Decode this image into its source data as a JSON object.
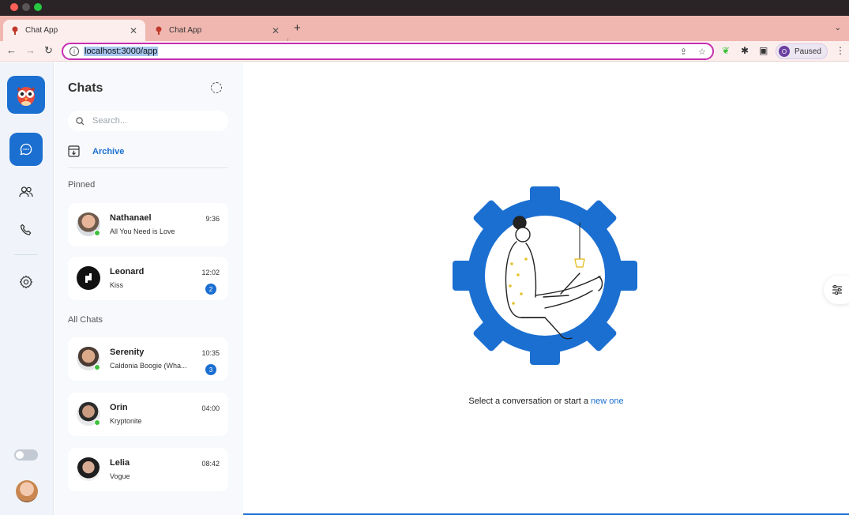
{
  "browser": {
    "tabs": [
      {
        "title": "Chat App",
        "active": true
      },
      {
        "title": "Chat App",
        "active": false
      }
    ],
    "url": "localhost:3000/app",
    "profile_status": "Paused",
    "profile_initial": "O"
  },
  "sidebar": {
    "title": "Chats",
    "search_placeholder": "Search...",
    "archive_label": "Archive",
    "pinned_label": "Pinned",
    "all_chats_label": "All Chats",
    "pinned": [
      {
        "name": "Nathanael",
        "message": "All You Need is Love",
        "time": "9:36",
        "unread": null,
        "online": true
      },
      {
        "name": "Leonard",
        "message": "Kiss",
        "time": "12:02",
        "unread": "2",
        "online": false
      }
    ],
    "all_chats": [
      {
        "name": "Serenity",
        "message": "Caldonia Boogie (Wha...",
        "time": "10:35",
        "unread": "3",
        "online": true
      },
      {
        "name": "Orin",
        "message": "Kryptonite",
        "time": "04:00",
        "unread": null,
        "online": true
      },
      {
        "name": "Lelia",
        "message": "Vogue",
        "time": "08:42",
        "unread": null,
        "online": false
      }
    ]
  },
  "main": {
    "empty_prefix": "Select a conversation or start a ",
    "empty_link": "new one"
  },
  "colors": {
    "accent": "#1b6fd1",
    "online": "#3cc13b",
    "omnibox_border": "#c62fb0",
    "tabstrip": "#f0b7b0"
  },
  "icons": [
    "chat-bubble-icon",
    "users-icon",
    "phone-icon",
    "gear-icon",
    "search-icon",
    "archive-icon",
    "filter-icon"
  ]
}
